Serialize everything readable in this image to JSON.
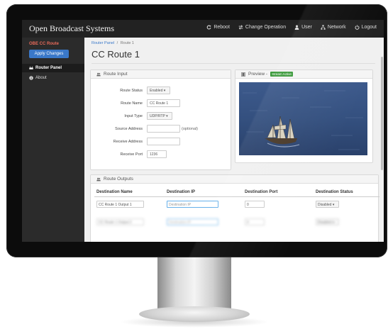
{
  "navbar": {
    "brand": "Open Broadcast Systems",
    "items": [
      {
        "label": "Reboot",
        "icon": "refresh-icon"
      },
      {
        "label": "Change Operation",
        "icon": "exchange-icon"
      },
      {
        "label": "User",
        "icon": "user-icon"
      },
      {
        "label": "Network",
        "icon": "network-icon"
      },
      {
        "label": "Logout",
        "icon": "power-icon"
      }
    ]
  },
  "sidebar": {
    "title": "OBE CC Route",
    "apply_label": "Apply Changes",
    "items": [
      {
        "label": "Router Panel",
        "icon": "router-icon",
        "active": true
      },
      {
        "label": "About",
        "icon": "info-icon",
        "active": false
      }
    ]
  },
  "main": {
    "breadcrumb": {
      "parent": "Router Panel",
      "separator": "/",
      "current": "Route 1"
    },
    "title": "CC Route 1",
    "route_input": {
      "heading": "Route Input",
      "fields": [
        {
          "label": "Route Status",
          "value": "Enabled ▾",
          "type": "select"
        },
        {
          "label": "Route Name",
          "value": "CC Route 1",
          "type": "text"
        },
        {
          "label": "Input Type",
          "value": "UDP/RTP ▾",
          "type": "select"
        },
        {
          "label": "Source Address",
          "value": "",
          "type": "text",
          "note": "(optional)"
        },
        {
          "label": "Receive Address",
          "value": "",
          "type": "text"
        },
        {
          "label": "Receive Port",
          "value": "1236",
          "type": "text"
        }
      ]
    },
    "preview": {
      "heading": "Preview -",
      "badge": "Stream Active"
    },
    "route_outputs": {
      "heading": "Route Outputs",
      "columns": [
        "Destination Name",
        "Destination IP",
        "Destination Port",
        "Destination Status"
      ],
      "rows": [
        {
          "name": "CC Route 1 Output 1",
          "ip_placeholder": "Destination IP",
          "port": "0",
          "status": "Disabled ▾"
        }
      ],
      "blurred_row": {
        "name": "CC Route 1 Output 2",
        "ip_placeholder": "Destination IP",
        "port": "0",
        "status": "Disabled ▾"
      }
    }
  },
  "colors": {
    "navbar": "#222222",
    "sidebar": "#2b2b2b",
    "accent": "#3a78c9",
    "badge": "#3c9a3c",
    "sidebar_title": "#e86a5a"
  }
}
